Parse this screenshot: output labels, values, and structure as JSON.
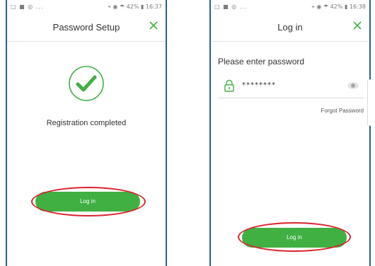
{
  "left_screen": {
    "status": {
      "left": "□ ■ ◎ ...",
      "right": "⌖ ◉ ☂ 42% ▮ 16:37"
    },
    "header": {
      "title": "Password Setup",
      "close_icon": "close-icon"
    },
    "success_icon": "check-icon",
    "message": "Registration completed",
    "login_button": "Log in",
    "highlight_color": "#d9242f"
  },
  "right_screen": {
    "status": {
      "left": "□ ■ ◎ ...",
      "right": "⌖ ◉ ☂ 42% ▮ 16:38"
    },
    "header": {
      "title": "Log in",
      "close_icon": "close-icon"
    },
    "prompt": "Please enter password",
    "password_value": "********",
    "lock_icon": "lock-icon",
    "eye_icon": "eye-icon",
    "forgot_password": "Forgot Password",
    "login_button": "Log in",
    "highlight_color": "#d9242f"
  },
  "colors": {
    "accent_green": "#41b043",
    "frame_blue": "#1f5fa0",
    "highlight_red": "#d9242f"
  }
}
